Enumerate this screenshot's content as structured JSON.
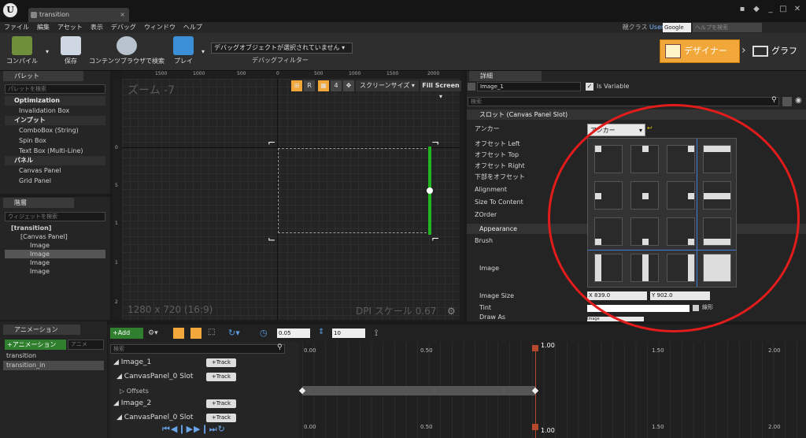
{
  "titlebar": {
    "tab_label": "transition",
    "parent_class_label": "親クラス",
    "parent_class_value": "User Widget",
    "search_engine": "Google",
    "help_placeholder": "ヘルプを検索"
  },
  "menubar": [
    "ファイル",
    "編集",
    "アセット",
    "表示",
    "デバッグ",
    "ウィンドウ",
    "ヘルプ"
  ],
  "toolbar": {
    "compile": "コンパイル",
    "save": "保存",
    "browse": "コンテンツブラウザで検索",
    "play": "プレイ",
    "debug_select": "デバッグオブジェクトが選択されていません",
    "debug_filter": "デバッグフィルター",
    "designer": "デザイナー",
    "graph": "グラフ"
  },
  "palette": {
    "tab": "パレット",
    "search_placeholder": "パレットを検索",
    "sections": [
      {
        "label": "Optimization",
        "items": [
          "Invalidation Box"
        ]
      },
      {
        "label": "インプット",
        "items": [
          "ComboBox (String)",
          "Spin Box",
          "Text Box (Multi-Line)"
        ]
      },
      {
        "label": "パネル",
        "items": [
          "Canvas Panel",
          "Grid Panel"
        ]
      }
    ]
  },
  "hierarchy": {
    "tab": "階層",
    "search_placeholder": "ウィジェットを検索",
    "root": "[transition]",
    "canvas": "[Canvas Panel]",
    "images": [
      "Image",
      "Image",
      "Image",
      "Image"
    ]
  },
  "viewport": {
    "zoom": "ズーム -7",
    "resolution": "1280 x 720 (16:9)",
    "dpi": "DPI スケール 0.67",
    "r_label": "R",
    "num_label": "4",
    "screen_size": "スクリーンサイズ",
    "fill_screen": "Fill Screen",
    "ruler_top": [
      "1500",
      "1000",
      "500",
      "0",
      "500",
      "1000",
      "1500",
      "2000"
    ],
    "ruler_left": [
      "0",
      "5",
      "1",
      "1",
      "2"
    ]
  },
  "details": {
    "tab": "詳細",
    "name": "Image_1",
    "is_variable": "Is Variable",
    "search_placeholder": "検索",
    "slot_section": "スロット (Canvas Panel Slot)",
    "anchor_label": "アンカー",
    "anchor_button": "アンカー",
    "rows": [
      "オフセット Left",
      "オフセット Top",
      "オフセット Right",
      "下部をオフセット",
      "Alignment",
      "Size To Content",
      "ZOrder"
    ],
    "appearance": "Appearance",
    "brush": "Brush",
    "image": "Image",
    "image_size": "Image Size",
    "size_x_label": "X",
    "size_x": "839.0",
    "size_y_label": "Y",
    "size_y": "902.0",
    "tint": "Tint",
    "tint_opt": "線形",
    "draw_as": "Draw As",
    "draw_as_value": "Image"
  },
  "animation": {
    "tab": "アニメーション",
    "add_button": "+アニメーション",
    "anim_search": "アニメ",
    "items": [
      "transition",
      "transition_in"
    ]
  },
  "timeline": {
    "add": "+Add",
    "time_value": "0.05",
    "frame_value": "10",
    "search_placeholder": "検索",
    "playhead": "1.00",
    "ticks": [
      "0.00",
      "0.50",
      "1.00",
      "1.50",
      "2.00"
    ],
    "tracks": [
      "Image_1",
      "CanvasPanel_0 Slot",
      "Offsets",
      "Image_2",
      "CanvasPanel_0 Slot"
    ],
    "track_btn": "+Track"
  }
}
